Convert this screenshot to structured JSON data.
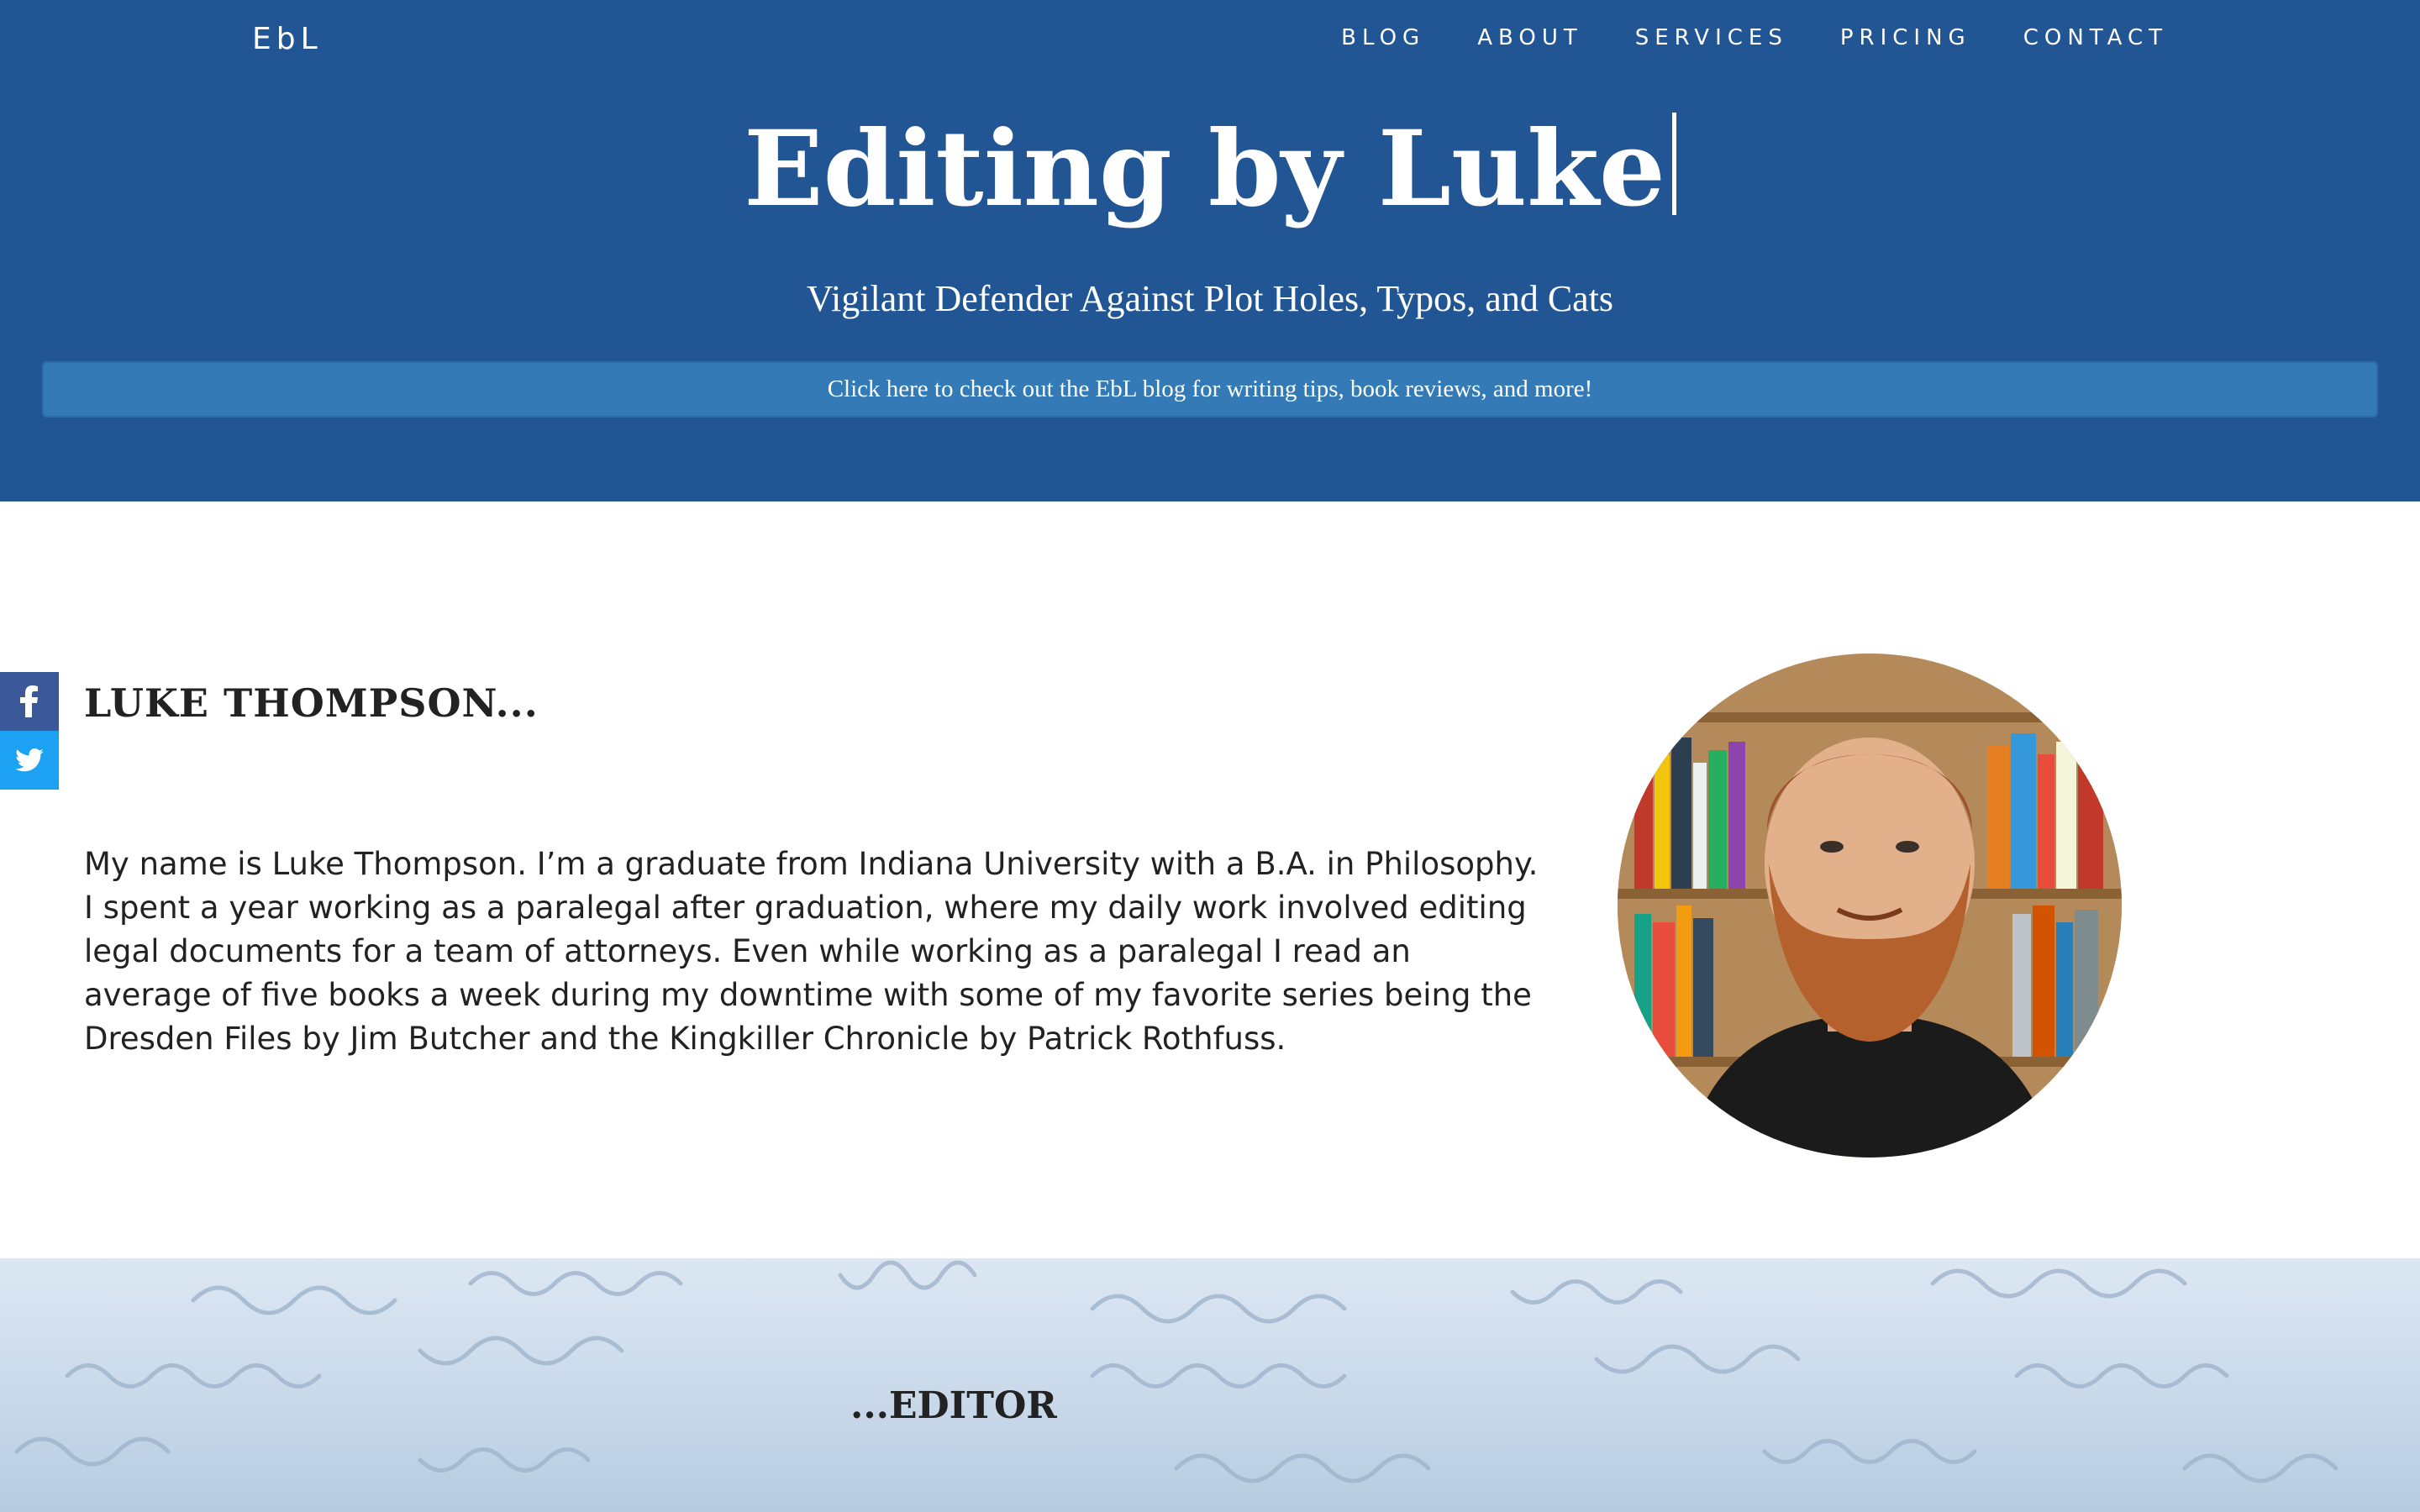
{
  "brand": "EbL",
  "nav": [
    "BLOG",
    "ABOUT",
    "SERVICES",
    "PRICING",
    "CONTACT"
  ],
  "hero": {
    "title": "Editing by Luke",
    "subtitle": "Vigilant Defender Against Plot Holes, Typos, and Cats",
    "blog_banner": "Click here to check out the EbL blog for writing tips, book reviews, and more!"
  },
  "social": [
    "facebook-icon",
    "twitter-icon"
  ],
  "about": {
    "heading": "LUKE THOMPSON...",
    "text": "My name is Luke Thompson. I’m a graduate from Indiana University with a B.A. in Philosophy. I spent a year working as a paralegal after graduation, where my daily work involved editing legal documents for a team of attorneys. Even while working as a paralegal I read an average of five books a week during my downtime with some of my favorite series being the Dresden Files by Jim Butcher and the Kingkiller Chronicle by Patrick Rothfuss."
  },
  "editor": {
    "heading": "...EDITOR"
  },
  "colors": {
    "header_bg": "#215594",
    "banner_bg": "#337ab7",
    "facebook": "#3b5998",
    "twitter": "#1da1f2"
  }
}
